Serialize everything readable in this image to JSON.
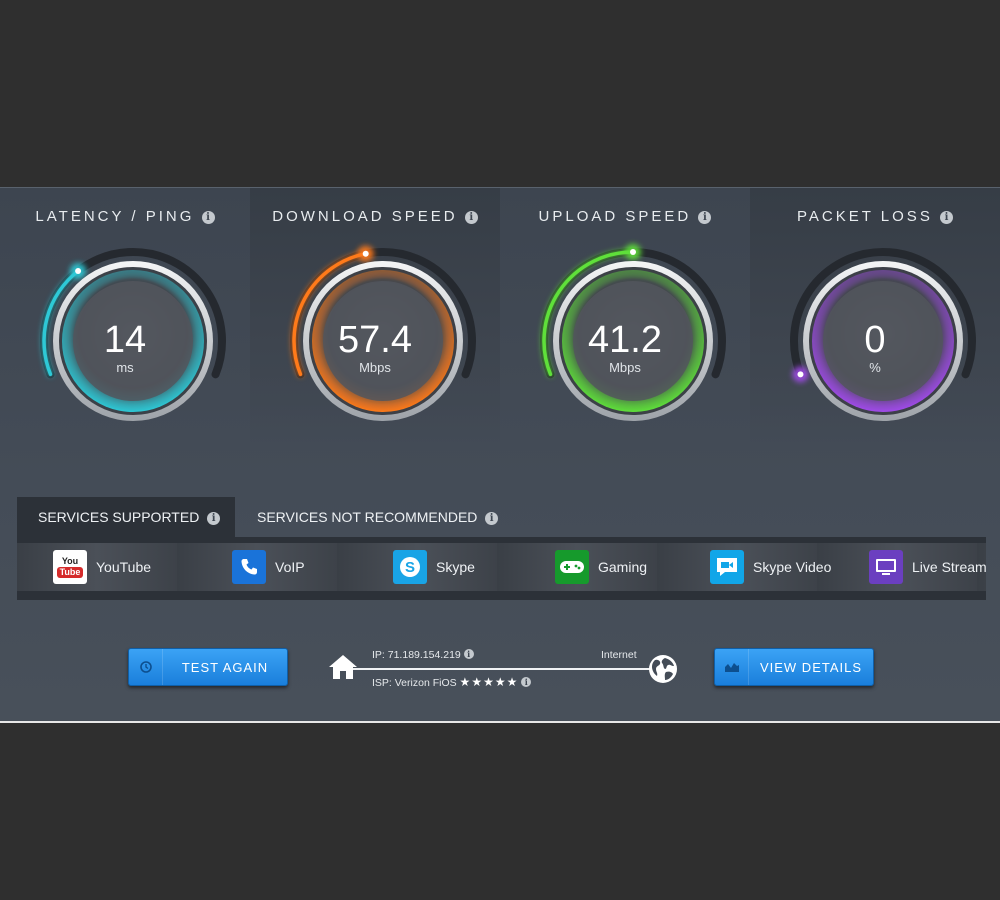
{
  "gauges": [
    {
      "title": "LATENCY / PING",
      "value": "14",
      "unit": "ms",
      "color": "#2ec9d6",
      "fill_fraction": 0.33
    },
    {
      "title": "DOWNLOAD SPEED",
      "value": "57.4",
      "unit": "Mbps",
      "color": "#ff7a1a",
      "fill_fraction": 0.45
    },
    {
      "title": "UPLOAD SPEED",
      "value": "41.2",
      "unit": "Mbps",
      "color": "#5fe03a",
      "fill_fraction": 0.5
    },
    {
      "title": "PACKET LOSS",
      "value": "0",
      "unit": "%",
      "color": "#a14bea",
      "fill_fraction": 0.0
    }
  ],
  "tabs": {
    "supported": "SERVICES SUPPORTED",
    "not_recommended": "SERVICES NOT RECOMMENDED"
  },
  "services": [
    {
      "label": "YouTube",
      "icon": "youtube-icon",
      "color": "#ffffff"
    },
    {
      "label": "VoIP",
      "icon": "phone-icon",
      "color": "#1a73d9"
    },
    {
      "label": "Skype",
      "icon": "skype-icon",
      "color": "#19a4e6"
    },
    {
      "label": "Gaming",
      "icon": "gamepad-icon",
      "color": "#169a2c"
    },
    {
      "label": "Skype Video",
      "icon": "video-chat-icon",
      "color": "#11a6e8"
    },
    {
      "label": "Live Streami",
      "icon": "monitor-icon",
      "color": "#6b3fc0"
    }
  ],
  "youtube_icon_text": {
    "top": "You",
    "bottom": "Tube"
  },
  "buttons": {
    "test_again": "TEST AGAIN",
    "view_details": "VIEW DETAILS"
  },
  "connection": {
    "ip": "IP: 71.189.154.219",
    "isp": "ISP: Verizon FiOS",
    "internet": "Internet",
    "isp_rating": 5
  }
}
